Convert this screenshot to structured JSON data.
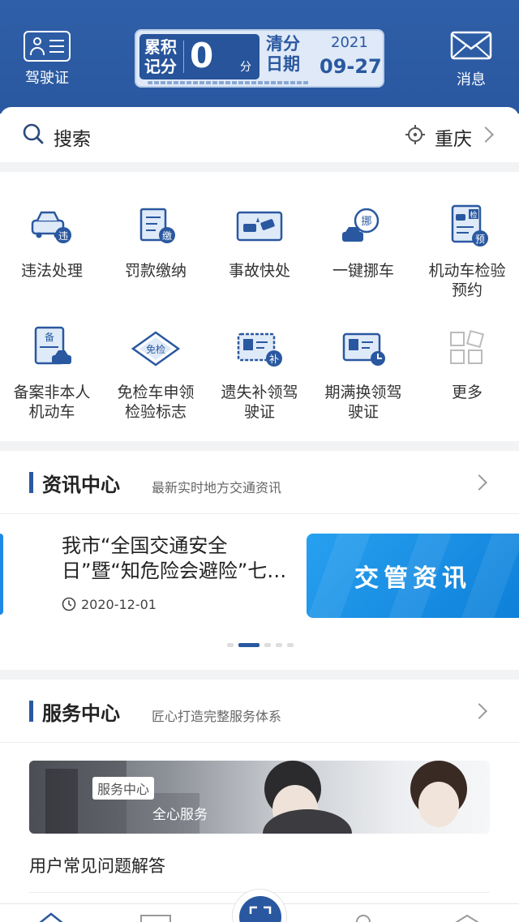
{
  "header": {
    "license_label": "驾驶证",
    "message_label": "消息",
    "score": {
      "label": "累积记分",
      "value": "0",
      "unit": "分",
      "clear_label": "清分日期",
      "year": "2021",
      "month_day": "09-27"
    }
  },
  "search": {
    "placeholder": "搜索",
    "city": "重庆"
  },
  "services": [
    {
      "label": "违法处理",
      "icon": "car-violation-icon",
      "badge": "违"
    },
    {
      "label": "罚款缴纳",
      "icon": "fine-payment-icon",
      "badge": "缴"
    },
    {
      "label": "事故快处",
      "icon": "accident-icon",
      "badge": ""
    },
    {
      "label": "一键挪车",
      "icon": "move-car-icon",
      "badge": "挪"
    },
    {
      "label": "机动车检验预约",
      "icon": "inspection-booking-icon",
      "badge": "检 预"
    },
    {
      "label": "备案非本人机动车",
      "icon": "vehicle-filing-icon",
      "badge": "备"
    },
    {
      "label": "免检车申领检验标志",
      "icon": "exempt-inspection-icon",
      "badge": "免检"
    },
    {
      "label": "遗失补领驾驶证",
      "icon": "reissue-license-icon",
      "badge": "补"
    },
    {
      "label": "期满换领驾驶证",
      "icon": "renew-license-icon",
      "badge": ""
    },
    {
      "label": "更多",
      "icon": "more-grid-icon",
      "badge": ""
    }
  ],
  "news": {
    "title": "资讯中心",
    "subtitle": "最新实时地方交通资讯",
    "item": {
      "title": "我市“全国交通安全日”暨“知危险会避险”七…",
      "date": "2020-12-01",
      "image_text": "交管资讯"
    }
  },
  "service_center": {
    "title": "服务中心",
    "subtitle": "匠心打造完整服务体系",
    "banner_tag": "服务中心",
    "banner_text": "全心服务",
    "faq": "用户常见问题解答"
  },
  "colors": {
    "brand": "#2a58a0",
    "accent": "#1e88e5"
  }
}
